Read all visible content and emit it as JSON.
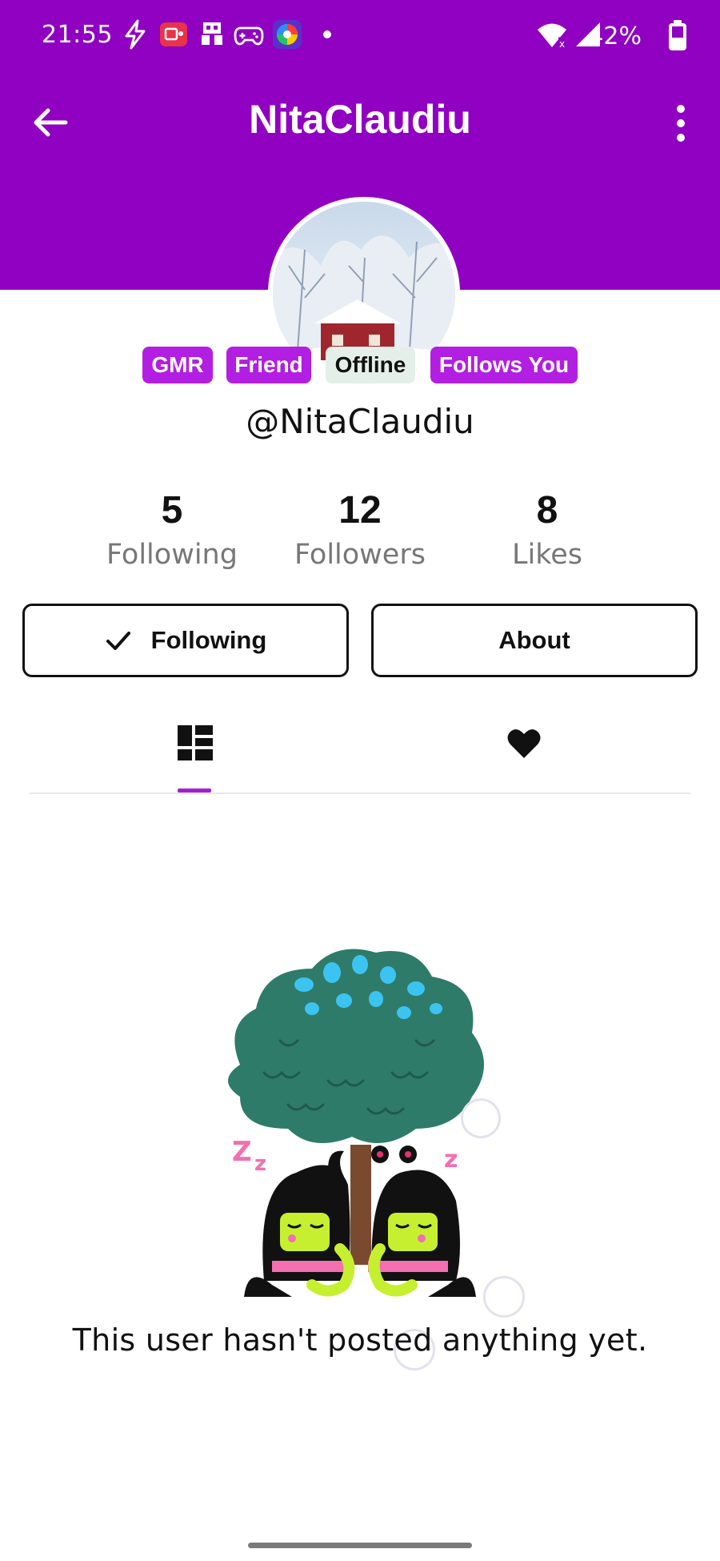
{
  "status_bar": {
    "time": "21:55",
    "battery": "42%",
    "left_icons": [
      "bolt-icon",
      "screen-record-icon",
      "game-controller-icon",
      "game-controller-icon",
      "color-wheel-icon",
      "dot-icon"
    ],
    "right_icons": [
      "wifi-icon",
      "signal-icon",
      "battery-icon"
    ]
  },
  "header": {
    "title": "NitaClaudiu",
    "background": "#9001c2"
  },
  "profile": {
    "handle": "@NitaClaudiu",
    "badges": [
      {
        "label": "GMR"
      },
      {
        "label": "Friend"
      },
      {
        "label": "Offline"
      },
      {
        "label": "Follows You"
      }
    ]
  },
  "stats": [
    {
      "value": "5",
      "label": "Following"
    },
    {
      "value": "12",
      "label": "Followers"
    },
    {
      "value": "8",
      "label": "Likes"
    }
  ],
  "actions": {
    "following_label": "Following",
    "about_label": "About"
  },
  "tabs": {
    "items": [
      "grid-icon",
      "heart-icon"
    ],
    "active": 0,
    "accent": "#a31fd6"
  },
  "empty_state": {
    "message": "This user hasn't posted anything yet."
  }
}
